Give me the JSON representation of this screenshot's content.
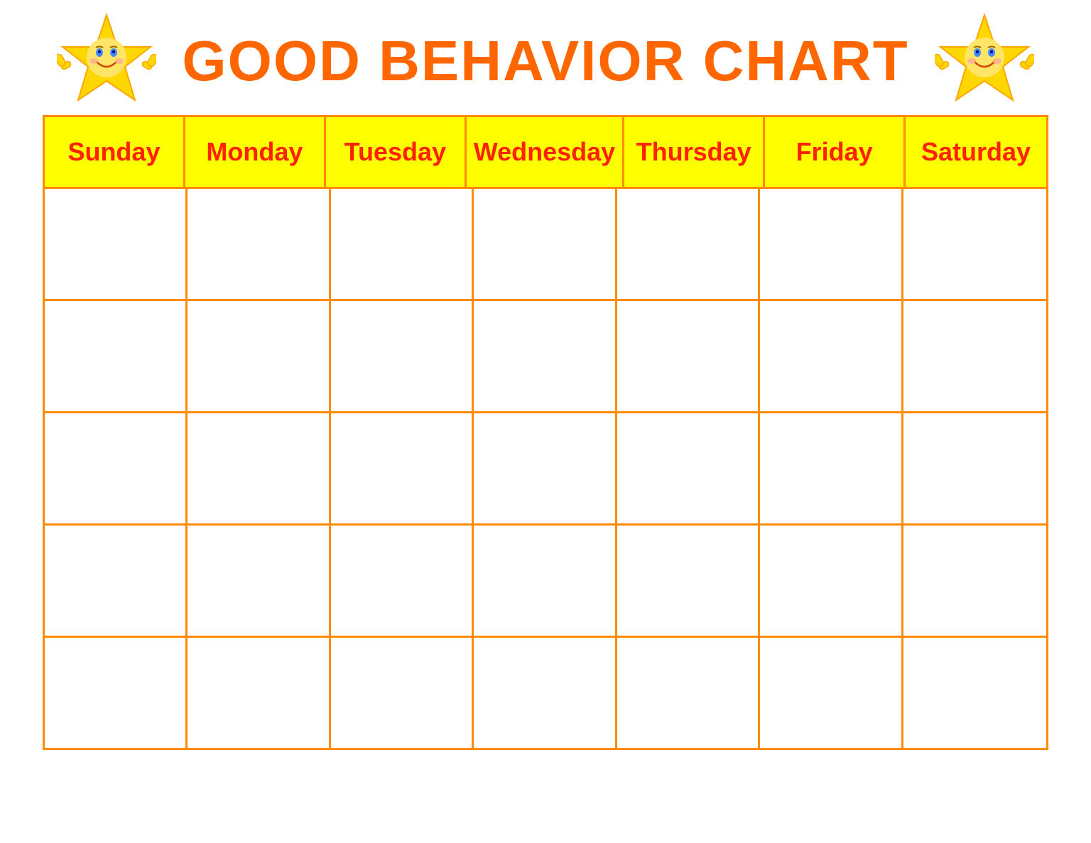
{
  "header": {
    "title": "GOOD BEHAVIOR CHART"
  },
  "days": [
    "Sunday",
    "Monday",
    "Tuesday",
    "Wednesday",
    "Thursday",
    "Friday",
    "Saturday"
  ],
  "rows": 5,
  "colors": {
    "title": "#FF6600",
    "header_bg": "#FFFF00",
    "day_text": "#FF2200",
    "border": "#FF8C00",
    "cell_bg": "#ffffff"
  },
  "star": {
    "label": "star with thumbs up"
  }
}
